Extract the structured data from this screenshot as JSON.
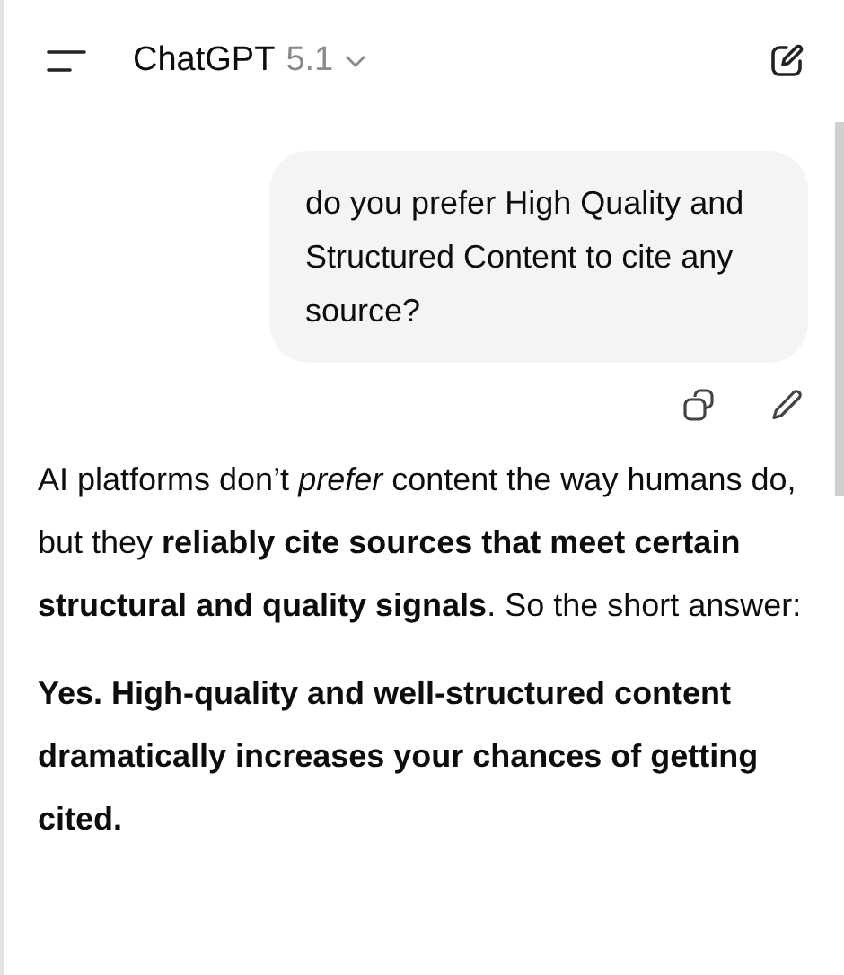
{
  "header": {
    "title": "ChatGPT",
    "version": "5.1"
  },
  "user_message": {
    "text": "do you prefer High Quality and Structured Content to cite any source?"
  },
  "reply": {
    "paragraphs": [
      {
        "text": "AI platforms don’t *prefer* content the way humans do, but they **reliably cite sources that meet certain structural and quality signals**. So the short answer:",
        "bold": false
      },
      {
        "text": "Yes. High-quality and well-structured content dramatically increases your chances of getting cited.",
        "bold": true
      }
    ]
  }
}
